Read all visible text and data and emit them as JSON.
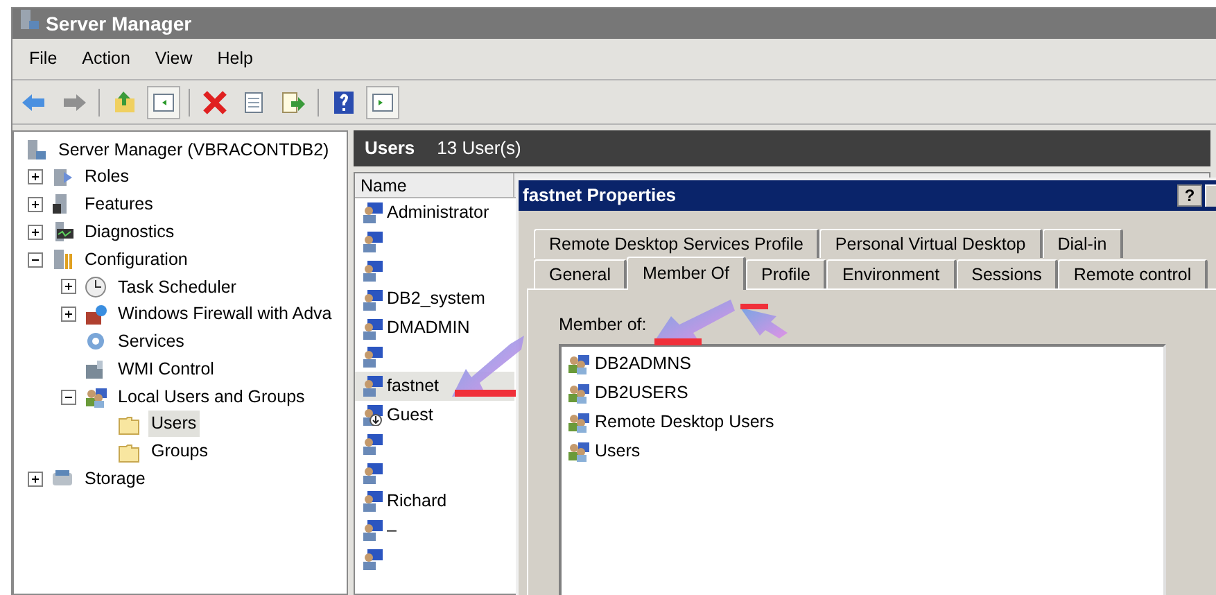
{
  "window": {
    "title": "Server Manager"
  },
  "menu": [
    "File",
    "Action",
    "View",
    "Help"
  ],
  "toolbar": [
    {
      "kind": "back",
      "pressed": false
    },
    {
      "kind": "forward",
      "pressed": false
    },
    {
      "kind": "sep"
    },
    {
      "kind": "up",
      "pressed": false
    },
    {
      "kind": "tree",
      "pressed": true
    },
    {
      "kind": "sep"
    },
    {
      "kind": "delete",
      "pressed": false
    },
    {
      "kind": "properties",
      "pressed": false
    },
    {
      "kind": "export",
      "pressed": false
    },
    {
      "kind": "sep"
    },
    {
      "kind": "help",
      "pressed": false
    },
    {
      "kind": "actions",
      "pressed": true
    }
  ],
  "tree": [
    {
      "label": "Server Manager (VBRACONTDB2)",
      "kind": "server",
      "selected": false,
      "children": [
        {
          "label": "Roles",
          "kind": "roles",
          "expanded": false,
          "selected": false
        },
        {
          "label": "Features",
          "kind": "features",
          "expanded": false,
          "selected": false
        },
        {
          "label": "Diagnostics",
          "kind": "diagnostics",
          "expanded": false,
          "selected": false
        },
        {
          "label": "Configuration",
          "kind": "configuration",
          "expanded": true,
          "selected": false,
          "children": [
            {
              "label": "Task Scheduler",
              "kind": "clock",
              "expanded": false,
              "selected": false
            },
            {
              "label": "Windows Firewall with Adva",
              "kind": "firewall",
              "expanded": false,
              "selected": false
            },
            {
              "label": "Services",
              "kind": "gear",
              "selected": false
            },
            {
              "label": "WMI Control",
              "kind": "wmi",
              "selected": false
            },
            {
              "label": "Local Users and Groups",
              "kind": "group",
              "expanded": true,
              "selected": false,
              "children": [
                {
                  "label": "Users",
                  "kind": "folder",
                  "selected": true
                },
                {
                  "label": "Groups",
                  "kind": "folder",
                  "selected": false
                }
              ]
            }
          ]
        },
        {
          "label": "Storage",
          "kind": "storage",
          "expanded": false,
          "selected": false
        }
      ]
    }
  ],
  "pane": {
    "title": "Users",
    "count": "13 User(s)",
    "columns": [
      "Name"
    ],
    "users": [
      {
        "name": "Administrator",
        "disabled": false,
        "selected": false
      },
      {
        "disabled": false,
        "selected": false
      },
      {
        "disabled": false,
        "selected": false
      },
      {
        "name": "DB2_system",
        "disabled": false,
        "selected": false
      },
      {
        "name": "DMADMIN",
        "disabled": false,
        "selected": false
      },
      {
        "disabled": false,
        "selected": false
      },
      {
        "name": "fastnet",
        "disabled": false,
        "selected": true
      },
      {
        "name": "Guest",
        "disabled": true,
        "selected": false
      },
      {
        "disabled": false,
        "selected": false
      },
      {
        "disabled": false,
        "selected": false
      },
      {
        "name": "Richard",
        "disabled": false,
        "selected": false
      },
      {
        "name": "–",
        "disabled": false,
        "selected": false
      },
      {
        "disabled": false,
        "selected": false
      }
    ]
  },
  "dialog": {
    "title": "fastnet Properties",
    "help_button": "?",
    "tab_rows": [
      [
        {
          "label": "Remote Desktop Services Profile",
          "selected": false
        },
        {
          "label": "Personal Virtual Desktop",
          "selected": false
        },
        {
          "label": "Dial-in",
          "selected": false
        }
      ],
      [
        {
          "label": "General",
          "selected": false
        },
        {
          "label": "Member Of",
          "selected": true
        },
        {
          "label": "Profile",
          "selected": false
        },
        {
          "label": "Environment",
          "selected": false
        },
        {
          "label": "Sessions",
          "selected": false
        },
        {
          "label": "Remote control",
          "selected": false
        }
      ]
    ],
    "member_of_label": "Member of:",
    "groups": [
      "DB2ADMNS",
      "DB2USERS",
      "Remote Desktop Users",
      "Users"
    ]
  }
}
